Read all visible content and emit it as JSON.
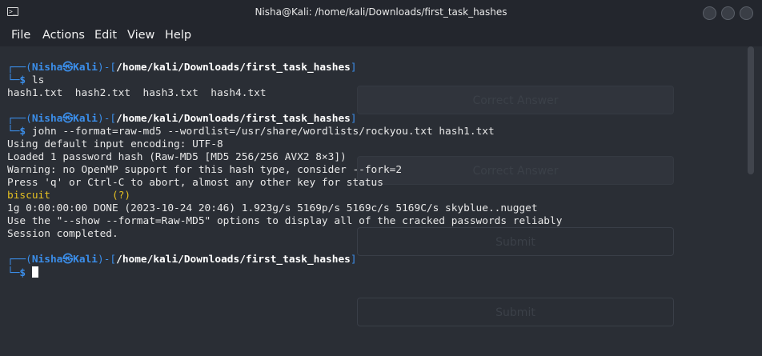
{
  "window": {
    "title": "Nisha@Kali: /home/kali/Downloads/first_task_hashes",
    "terminal_icon": "terminal-icon"
  },
  "menu": [
    "File",
    "Actions",
    "Edit",
    "View",
    "Help"
  ],
  "overlay_buttons": [
    "Correct Answer",
    "Correct Answer",
    "Submit",
    "Submit"
  ],
  "prompt": {
    "user": "Nisha",
    "host": "Kali",
    "path": "/home/kali/Downloads/first_task_hashes",
    "open": "┌──(",
    "sep": "㉿",
    "mid": ")-[",
    "close": "]",
    "second": "└─",
    "dollar": "$"
  },
  "commands": {
    "ls": "ls",
    "john": "john --format=raw-md5 --wordlist=/usr/share/wordlists/rockyou.txt hash1.txt"
  },
  "output": {
    "ls": "hash1.txt  hash2.txt  hash3.txt  hash4.txt",
    "encoding": "Using default input encoding: UTF-8",
    "loaded": "Loaded 1 password hash (Raw-MD5 [MD5 256/256 AVX2 8×3])",
    "warning": "Warning: no OpenMP support for this hash type, consider --fork=2",
    "press": "Press 'q' or Ctrl-C to abort, almost any other key for status",
    "cracked_password": "biscuit",
    "cracked_pad": "          ",
    "cracked_hash_label": "(?)",
    "stats": "1g 0:00:00:00 DONE (2023-10-24 20:46) 1.923g/s 5169p/s 5169c/s 5169C/s skyblue..nugget",
    "show": "Use the \"--show --format=Raw-MD5\" options to display all of the cracked passwords reliably",
    "session": "Session completed."
  },
  "colors": {
    "background": "#2a2e35",
    "prompt_blue": "#3b8eea",
    "password_yellow": "#e5c022"
  }
}
